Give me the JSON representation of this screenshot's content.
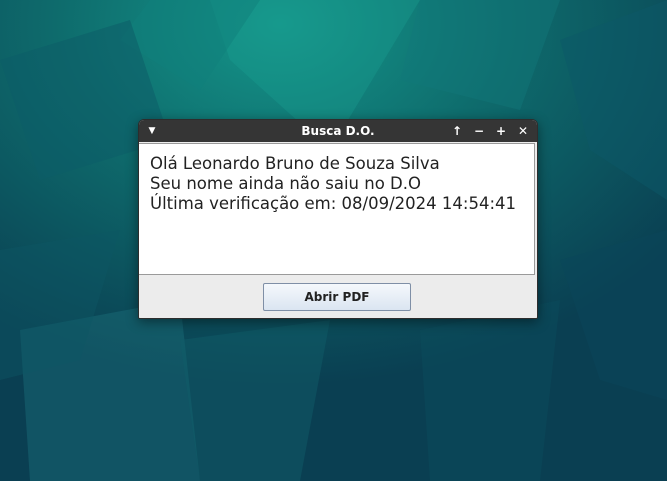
{
  "window": {
    "title": "Busca D.O.",
    "menu_icon": "chevron-down-icon",
    "controls": {
      "up_icon": "arrow-up-icon",
      "minimize_icon": "minimize-icon",
      "maximize_icon": "maximize-icon",
      "close_icon": "close-icon"
    }
  },
  "message": {
    "line1": "Olá Leonardo Bruno de Souza Silva",
    "line2": "Seu nome ainda não saiu no D.O",
    "line3": "Última verificação em: 08/09/2024 14:54:41"
  },
  "button": {
    "label": "Abrir PDF"
  },
  "colors": {
    "desktop_base": "#0b4f5a",
    "titlebar": "#353535",
    "window_bg": "#ececec"
  }
}
